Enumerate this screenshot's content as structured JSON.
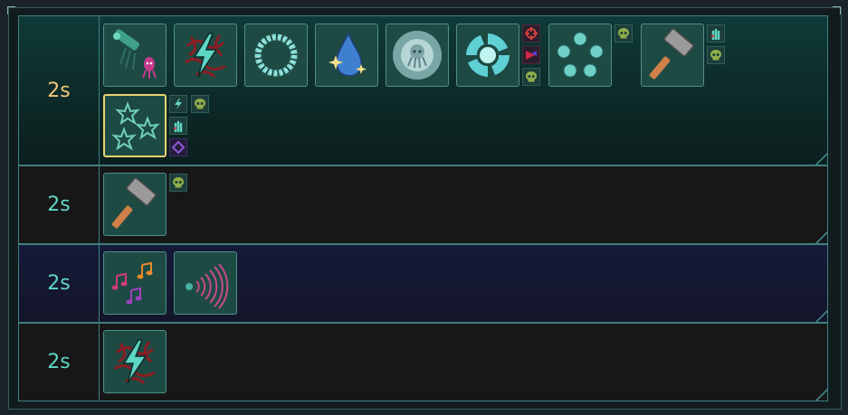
{
  "rows": [
    {
      "time_label": "2s",
      "active": true,
      "abilities": [
        "summon-squid-icon",
        "chaos-bolt-icon",
        "frost-ring-icon",
        "water-drop-sparkle-icon",
        "spectral-squid-icon",
        "vortex-icon",
        "orb-circle-icon",
        "hammer-icon",
        "shuriken-icon"
      ]
    },
    {
      "time_label": "2s",
      "active": false,
      "abilities": [
        "hammer-icon"
      ]
    },
    {
      "time_label": "2s",
      "active": false,
      "abilities": [
        "music-notes-icon",
        "sound-wave-icon"
      ]
    },
    {
      "time_label": "2s",
      "active": false,
      "abilities": [
        "chaos-bolt-icon"
      ]
    }
  ],
  "colors": {
    "accent": "#5fd6c4",
    "active_time": "#f0c87a",
    "selected_border": "#e8d470",
    "skull": "#8fae4a"
  }
}
